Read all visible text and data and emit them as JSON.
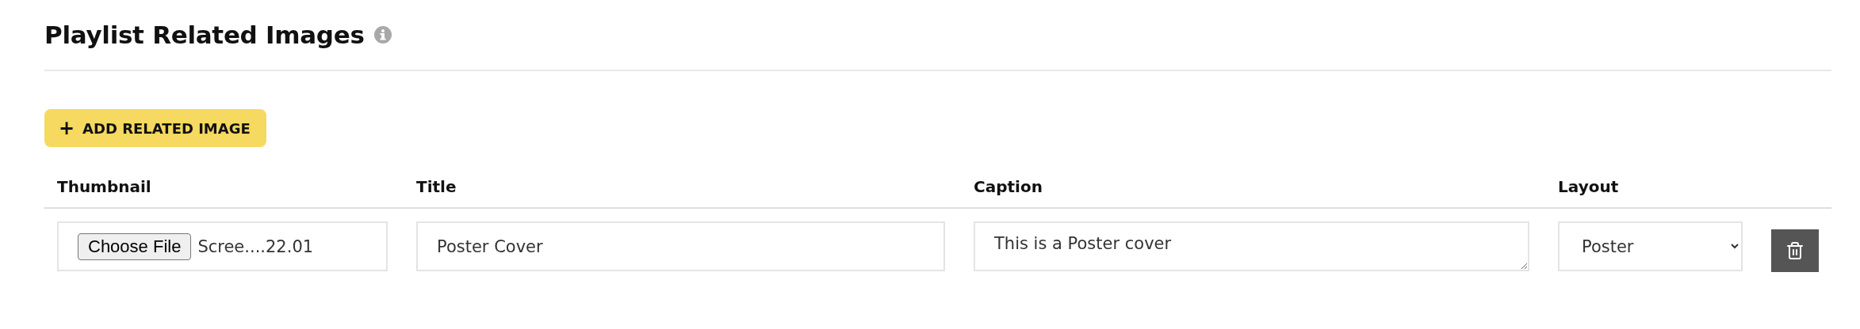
{
  "section": {
    "title": "Playlist Related Images"
  },
  "add_button": {
    "icon": "+",
    "label": "ADD RELATED IMAGE"
  },
  "table": {
    "columns": [
      "Thumbnail",
      "Title",
      "Caption",
      "Layout"
    ],
    "rows": [
      {
        "thumbnail": {
          "button": "Choose File",
          "file_name": "Scree....22.01"
        },
        "title": "Poster Cover",
        "caption": "This is a Poster cover",
        "layout": "Poster"
      }
    ]
  }
}
